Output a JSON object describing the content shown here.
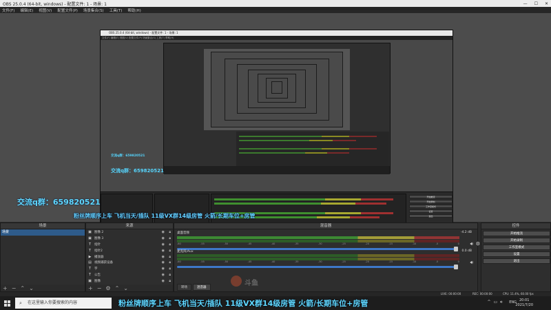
{
  "window": {
    "title": "OBS 25.0.4 (64-bit, windows) - 配置文件: 1 - 场景: 1",
    "controls": [
      "—",
      "☐",
      "✕"
    ]
  },
  "menu": [
    "文件(F)",
    "编辑(E)",
    "视图(V)",
    "配置文件(P)",
    "场景集合(S)",
    "工具(T)",
    "帮助(H)"
  ],
  "nested_capture": {
    "title": "OBS 25.0.4 (64-bit, windows) - 配置文件: 1 - 场景: 1",
    "menu": "文件(F)  编辑(E)  视图(V)  配置文件(P)  场景集合(S)  工具(T)  帮助(H)",
    "search_placeholder": "在这里输入你要搜索的内容",
    "qq_small": "交流q群：659820521",
    "qq_mid": "交流q群：659820521",
    "overlay": "粉丝牌顺序上车 飞机当天/插队 11级VX群14级房管 火箭/长期车位+房管",
    "buttons": [
      "开始推流",
      "开始录制",
      "工作室模式",
      "设置",
      "退出"
    ]
  },
  "overlay_qq": "交流q群：659820521",
  "overlay_ticker": "粉丝牌顺序上车 飞机当天/插队 11级VX群14级房管 火箭/长期车位+房管",
  "scenes": {
    "header": "场景",
    "items": [
      "场景"
    ]
  },
  "sources": {
    "header": "来源",
    "items": [
      {
        "icon": "image",
        "label": "图像 2"
      },
      {
        "icon": "image",
        "label": "图像 3"
      },
      {
        "icon": "text",
        "label": "指针"
      },
      {
        "icon": "text",
        "label": "指针2"
      },
      {
        "icon": "media",
        "label": "播放器"
      },
      {
        "icon": "camera",
        "label": "视频捕获设备"
      },
      {
        "icon": "text",
        "label": "字"
      },
      {
        "icon": "text",
        "label": "公告"
      },
      {
        "icon": "image",
        "label": "图像"
      },
      {
        "icon": "text",
        "label": "文字"
      }
    ]
  },
  "mixer": {
    "header": "混音器",
    "tracks": [
      {
        "name": "桌面音频",
        "db": "-4.2 dB"
      },
      {
        "name": "麦克风/Aux",
        "db": "0.0 dB"
      }
    ],
    "ticks": [
      "-60",
      "-55",
      "-50",
      "-45",
      "-40",
      "-35",
      "-30",
      "-25",
      "-20",
      "-15",
      "-10",
      "-5",
      "0"
    ],
    "tabs": [
      "转场",
      "混音器"
    ]
  },
  "controls": {
    "header": "控件",
    "buttons": [
      "开始推流",
      "开始录制",
      "工作室模式",
      "设置",
      "退出"
    ]
  },
  "status": {
    "live": "LIVE: 00:00:00",
    "rec": "REC: 00:00:00",
    "cpu": "CPU: 11.4%, 60.00 fps"
  },
  "taskbar": {
    "search_placeholder": "在这里输入你要搜索的内容",
    "lang": "ENG",
    "time": "20:01",
    "date": "2021/7/20"
  },
  "watermark": "斗鱼"
}
